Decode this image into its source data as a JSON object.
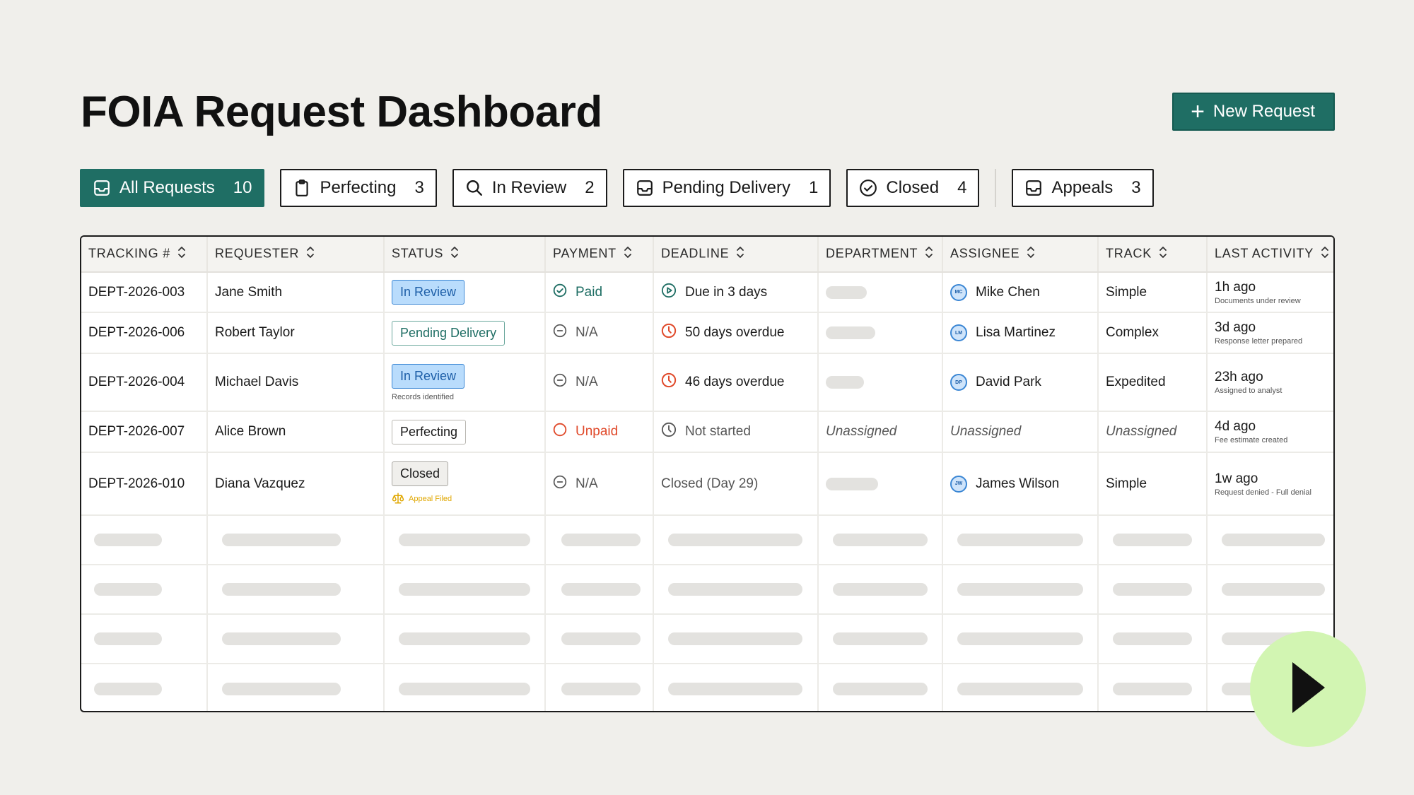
{
  "header": {
    "title": "FOIA Request Dashboard",
    "new_button_label": "New Request"
  },
  "tabs": [
    {
      "label": "All Requests",
      "count": "10",
      "icon": "inbox-icon",
      "active": true
    },
    {
      "label": "Perfecting",
      "count": "3",
      "icon": "clipboard-icon",
      "active": false
    },
    {
      "label": "In Review",
      "count": "2",
      "icon": "search-icon",
      "active": false
    },
    {
      "label": "Pending Delivery",
      "count": "1",
      "icon": "inbox-icon",
      "active": false
    },
    {
      "label": "Closed",
      "count": "4",
      "icon": "check-circle-icon",
      "active": false
    },
    {
      "label": "Appeals",
      "count": "3",
      "icon": "inbox-icon",
      "active": false
    }
  ],
  "table": {
    "columns": [
      "TRACKING #",
      "REQUESTER",
      "STATUS",
      "PAYMENT",
      "DEADLINE",
      "DEPARTMENT",
      "ASSIGNEE",
      "TRACK",
      "LAST ACTIVITY"
    ],
    "rows": [
      {
        "tracking": "DEPT-2026-003",
        "requester": "Jane Smith",
        "status": "In Review",
        "status_note": "",
        "appeal": "",
        "payment": "Paid",
        "deadline": "Due in 3 days",
        "assignee": "Mike Chen",
        "initials": "MC",
        "track": "Simple",
        "activity": "1h ago",
        "activity_note": "Documents under review"
      },
      {
        "tracking": "DEPT-2026-006",
        "requester": "Robert Taylor",
        "status": "Pending Delivery",
        "status_note": "",
        "appeal": "",
        "payment": "N/A",
        "deadline": "50 days overdue",
        "assignee": "Lisa Martinez",
        "initials": "LM",
        "track": "Complex",
        "activity": "3d ago",
        "activity_note": "Response letter prepared"
      },
      {
        "tracking": "DEPT-2026-004",
        "requester": "Michael Davis",
        "status": "In Review",
        "status_note": "Records identified",
        "appeal": "",
        "payment": "N/A",
        "deadline": "46 days overdue",
        "assignee": "David Park",
        "initials": "DP",
        "track": "Expedited",
        "activity": "23h ago",
        "activity_note": "Assigned to analyst"
      },
      {
        "tracking": "DEPT-2026-007",
        "requester": "Alice Brown",
        "status": "Perfecting",
        "status_note": "",
        "appeal": "",
        "payment": "Unpaid",
        "deadline": "Not started",
        "department": "Unassigned",
        "assignee": "Unassigned",
        "track": "Unassigned",
        "activity": "4d ago",
        "activity_note": "Fee estimate created"
      },
      {
        "tracking": "DEPT-2026-010",
        "requester": "Diana Vazquez",
        "status": "Closed",
        "status_note": "",
        "appeal": "Appeal Filed",
        "payment": "N/A",
        "deadline": "Closed (Day 29)",
        "assignee": "James Wilson",
        "initials": "JW",
        "track": "Simple",
        "activity": "1w ago",
        "activity_note": "Request denied - Full denial"
      }
    ]
  },
  "colors": {
    "accent": "#1f6e64",
    "background": "#f0efeb",
    "review_badge": "#b9dcfc",
    "overdue": "#e04a2b",
    "appeal": "#e0a700",
    "play_button": "#d2f5b2"
  }
}
